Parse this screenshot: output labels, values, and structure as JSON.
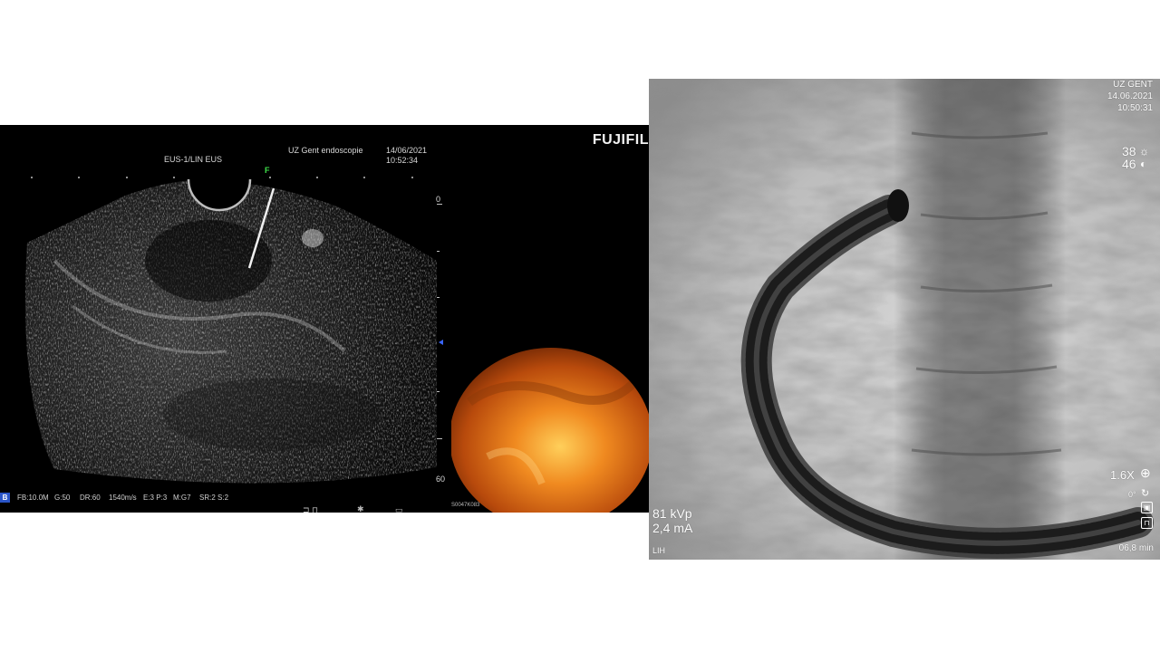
{
  "eus_panel": {
    "brand": "FUJIFIL",
    "mode_label": "EUS-1/LIN EUS",
    "institution": "UZ Gent endoscopie",
    "date": "14/06/2021",
    "time": "10:52:34",
    "focus_marker": "F",
    "scale_top": "0",
    "scale_bottom": "60",
    "mode_badge": "B",
    "params": {
      "fb": "FB:10.0M",
      "gain": "G:50",
      "dr": "DR:60",
      "sound_speed": "1540m/s",
      "e": "E:3 P:3",
      "m": "M:G7",
      "sr": "SR:2 S:2"
    },
    "endo_code": "S0047K083",
    "colors": {
      "background": "#000000",
      "endo_accent": "#f07818",
      "focus": "#3ee04a",
      "badge": "#2a55c8"
    },
    "icons": [
      "probe-icon",
      "freeze-icon",
      "star-icon",
      "depth-icon"
    ]
  },
  "fluoro_panel": {
    "institution": "UZ GENT",
    "date": "14.06.2021",
    "time": "10:50:31",
    "brightness": "38",
    "contrast": "46",
    "kvp": "81 kVp",
    "ma": "2,4 mA",
    "zoom": "1.6X",
    "rotation": "0°",
    "orientation": "LIH",
    "fluoro_time": "06,8 min",
    "icons": [
      "sun-icon",
      "half-circle-icon",
      "zoom-icon",
      "rotate-icon",
      "image-icon",
      "collimator-icon"
    ]
  }
}
